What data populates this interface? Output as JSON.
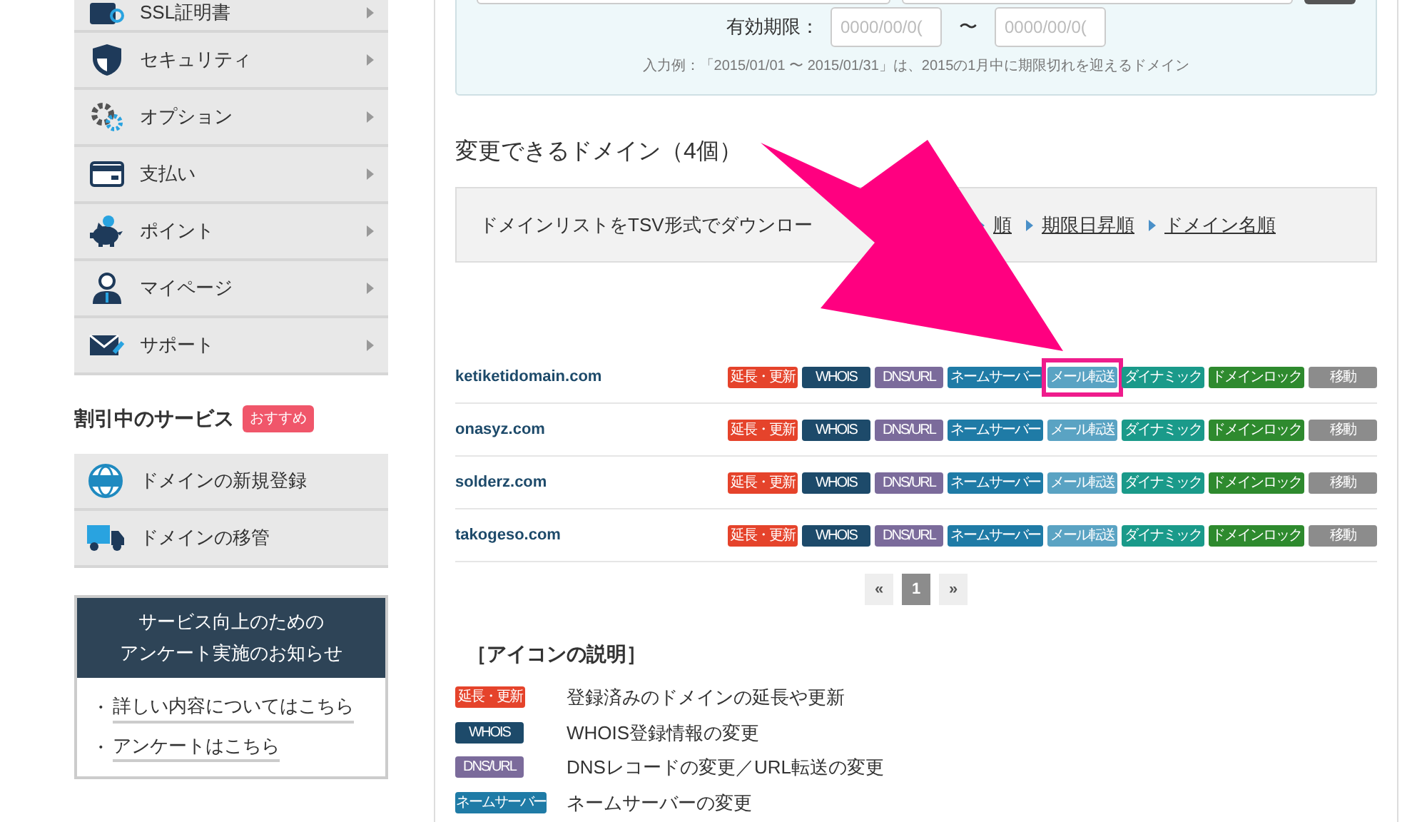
{
  "sidebar": {
    "menu": [
      {
        "label": "SSL証明書"
      },
      {
        "label": "セキュリティ"
      },
      {
        "label": "オプション"
      },
      {
        "label": "支払い"
      },
      {
        "label": "ポイント"
      },
      {
        "label": "マイページ"
      },
      {
        "label": "サポート"
      }
    ],
    "discount": {
      "title": "割引中のサービス",
      "badge": "おすすめ",
      "items": [
        {
          "label": "ドメインの新規登録"
        },
        {
          "label": "ドメインの移管"
        }
      ]
    },
    "notice": {
      "title_lines": [
        "サービス向上のための",
        "アンケート実施のお知らせ"
      ],
      "links": [
        "詳しい内容についてはこちら",
        "アンケートはこちら"
      ],
      "bullet": "・"
    }
  },
  "filter": {
    "expiry_label": "有効期限：",
    "from_placeholder": "0000/00/0(",
    "separator": "〜",
    "to_placeholder": "0000/00/0(",
    "example": "入力例：「2015/01/01 〜 2015/01/31」は、2015の1月中に期限切れを迎えるドメイン"
  },
  "domains": {
    "title": "変更できるドメイン（4個）",
    "download_text": "ドメインリストをTSV形式でダウンロー",
    "sort_links": [
      "順",
      "期限日昇順",
      "ドメイン名順"
    ],
    "rows": [
      {
        "name": "ketiketidomain.com",
        "actions": [
          {
            "label": "延長・更新",
            "kind": "renew",
            "highlighted": false
          },
          {
            "label": "WHOIS",
            "kind": "whois",
            "highlighted": false
          },
          {
            "label": "DNS/URL",
            "kind": "dns",
            "highlighted": false
          },
          {
            "label": "ネームサーバー",
            "kind": "ns",
            "highlighted": false
          },
          {
            "label": "メール転送",
            "kind": "mail",
            "highlighted": true
          },
          {
            "label": "ダイナミック",
            "kind": "dynamic",
            "highlighted": false
          },
          {
            "label": "ドメインロック",
            "kind": "lock",
            "highlighted": false
          },
          {
            "label": "移動",
            "kind": "move",
            "highlighted": false
          }
        ]
      },
      {
        "name": "onasyz.com",
        "actions": [
          {
            "label": "延長・更新",
            "kind": "renew",
            "highlighted": false
          },
          {
            "label": "WHOIS",
            "kind": "whois",
            "highlighted": false
          },
          {
            "label": "DNS/URL",
            "kind": "dns",
            "highlighted": false
          },
          {
            "label": "ネームサーバー",
            "kind": "ns",
            "highlighted": false
          },
          {
            "label": "メール転送",
            "kind": "mail",
            "highlighted": false
          },
          {
            "label": "ダイナミック",
            "kind": "dynamic",
            "highlighted": false
          },
          {
            "label": "ドメインロック",
            "kind": "lock",
            "highlighted": false
          },
          {
            "label": "移動",
            "kind": "move",
            "highlighted": false
          }
        ]
      },
      {
        "name": "solderz.com",
        "actions": [
          {
            "label": "延長・更新",
            "kind": "renew",
            "highlighted": false
          },
          {
            "label": "WHOIS",
            "kind": "whois",
            "highlighted": false
          },
          {
            "label": "DNS/URL",
            "kind": "dns",
            "highlighted": false
          },
          {
            "label": "ネームサーバー",
            "kind": "ns",
            "highlighted": false
          },
          {
            "label": "メール転送",
            "kind": "mail",
            "highlighted": false
          },
          {
            "label": "ダイナミック",
            "kind": "dynamic",
            "highlighted": false
          },
          {
            "label": "ドメインロック",
            "kind": "lock",
            "highlighted": false
          },
          {
            "label": "移動",
            "kind": "move",
            "highlighted": false
          }
        ]
      },
      {
        "name": "takogeso.com",
        "actions": [
          {
            "label": "延長・更新",
            "kind": "renew",
            "highlighted": false
          },
          {
            "label": "WHOIS",
            "kind": "whois",
            "highlighted": false
          },
          {
            "label": "DNS/URL",
            "kind": "dns",
            "highlighted": false
          },
          {
            "label": "ネームサーバー",
            "kind": "ns",
            "highlighted": false
          },
          {
            "label": "メール転送",
            "kind": "mail",
            "highlighted": false
          },
          {
            "label": "ダイナミック",
            "kind": "dynamic",
            "highlighted": false
          },
          {
            "label": "ドメインロック",
            "kind": "lock",
            "highlighted": false
          },
          {
            "label": "移動",
            "kind": "move",
            "highlighted": false
          }
        ]
      }
    ],
    "pagination": [
      {
        "label": "«",
        "selected": false
      },
      {
        "label": "1",
        "selected": true
      },
      {
        "label": "»",
        "selected": false
      }
    ]
  },
  "legend": {
    "title": "［アイコンの説明］",
    "items": [
      {
        "badge": "延長・更新",
        "kind": "renew",
        "text": "登録済みのドメインの延長や更新"
      },
      {
        "badge": "WHOIS",
        "kind": "whois",
        "text": "WHOIS登録情報の変更"
      },
      {
        "badge": "DNS/URL",
        "kind": "dns",
        "text": "DNSレコードの変更／URL転送の変更"
      },
      {
        "badge": "ネームサーバー",
        "kind": "ns",
        "text": "ネームサーバーの変更"
      }
    ]
  }
}
